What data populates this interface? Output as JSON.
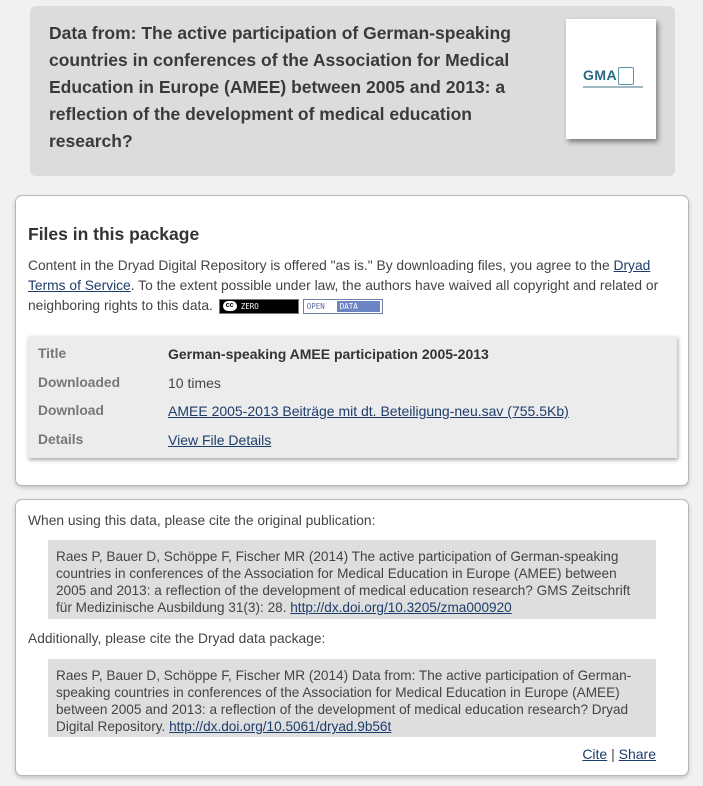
{
  "header": {
    "title": "Data from: The active participation of German-speaking countries in conferences of the Association for Medical Education in Europe (AMEE) between 2005 and 2013: a reflection of the development of medical education research?",
    "thumbnail_logo": "GMA"
  },
  "files": {
    "heading": "Files in this package",
    "terms_prefix": "Content in the Dryad Digital Repository is offered \"as is.\" By downloading files, you agree to the ",
    "terms_link": "Dryad Terms of Service",
    "terms_suffix": ". To the extent possible under law, the authors have waived all copyright and related or neighboring rights to this data.",
    "badges": {
      "cc0_symbol": "cc",
      "cc0_label": "ZERO",
      "open_label": "OPEN",
      "data_label": "DATA"
    },
    "rows": [
      {
        "label": "Title",
        "value": "German-speaking AMEE participation 2005-2013"
      },
      {
        "label": "Downloaded",
        "value": "10 times"
      },
      {
        "label": "Download",
        "value": "AMEE 2005-2013 Beiträge mit dt. Beteiligung-neu.sav (755.5Kb)"
      },
      {
        "label": "Details",
        "value": "View File Details"
      }
    ]
  },
  "citation": {
    "intro_publication": "When using this data, please cite the original publication:",
    "publication_text": "Raes P, Bauer D, Schöppe F, Fischer MR (2014) The active participation of German-speaking countries in conferences of the Association for Medical Education in Europe (AMEE) between 2005 and 2013: a reflection of the development of medical education research? GMS Zeitschrift für Medizinische Ausbildung 31(3): 28. ",
    "publication_doi": "http://dx.doi.org/10.3205/zma000920",
    "intro_package": "Additionally, please cite the Dryad data package:",
    "package_text": "Raes P, Bauer D, Schöppe F, Fischer MR (2014) Data from: The active participation of German-speaking countries in conferences of the Association for Medical Education in Europe (AMEE) between 2005 and 2013: a reflection of the development of medical education research? Dryad Digital Repository. ",
    "package_doi": "http://dx.doi.org/10.5061/dryad.9b56t",
    "cite_label": "Cite",
    "separator": "|",
    "share_label": "Share"
  }
}
